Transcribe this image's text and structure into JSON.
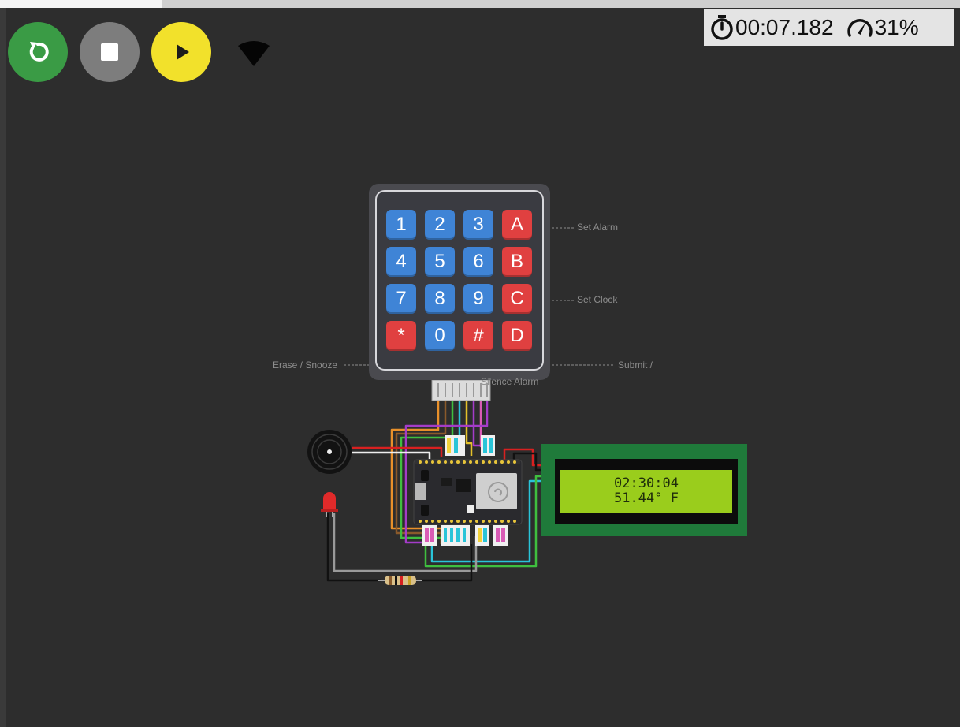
{
  "toolbar": {
    "restart_icon": "restart-icon",
    "stop_icon": "stop-icon",
    "play_icon": "play-icon",
    "wifi_icon": "wifi-icon"
  },
  "status": {
    "timer_icon": "stopwatch-icon",
    "elapsed": "00:07.182",
    "speed_icon": "speedometer-icon",
    "speed": "31%"
  },
  "keypad": {
    "rows": [
      [
        {
          "label": "1",
          "color": "#3f84d6"
        },
        {
          "label": "2",
          "color": "#3f84d6"
        },
        {
          "label": "3",
          "color": "#3f84d6"
        },
        {
          "label": "A",
          "color": "#e04040"
        }
      ],
      [
        {
          "label": "4",
          "color": "#3f84d6"
        },
        {
          "label": "5",
          "color": "#3f84d6"
        },
        {
          "label": "6",
          "color": "#3f84d6"
        },
        {
          "label": "B",
          "color": "#e04040"
        }
      ],
      [
        {
          "label": "7",
          "color": "#3f84d6"
        },
        {
          "label": "8",
          "color": "#3f84d6"
        },
        {
          "label": "9",
          "color": "#3f84d6"
        },
        {
          "label": "C",
          "color": "#e04040"
        }
      ],
      [
        {
          "label": "*",
          "color": "#e04040"
        },
        {
          "label": "0",
          "color": "#3f84d6"
        },
        {
          "label": "#",
          "color": "#e04040"
        },
        {
          "label": "D",
          "color": "#e04040"
        }
      ]
    ]
  },
  "annotations": {
    "set_alarm": "Set Alarm",
    "set_clock": "Set Clock",
    "erase_snooze": "Erase / Snooze",
    "submit": "Submit /",
    "silence_alarm": "Silence Alarm"
  },
  "lcd": {
    "line1": "02:30:04",
    "line2": "51.44° F"
  },
  "colors": {
    "restart": "#3a9b45",
    "stop": "#7d7d7d",
    "play": "#f2e12b",
    "canvas": "#2d2d2d",
    "lcd_screen": "#9acd1c",
    "lcd_pcb": "#1f7a3a"
  }
}
